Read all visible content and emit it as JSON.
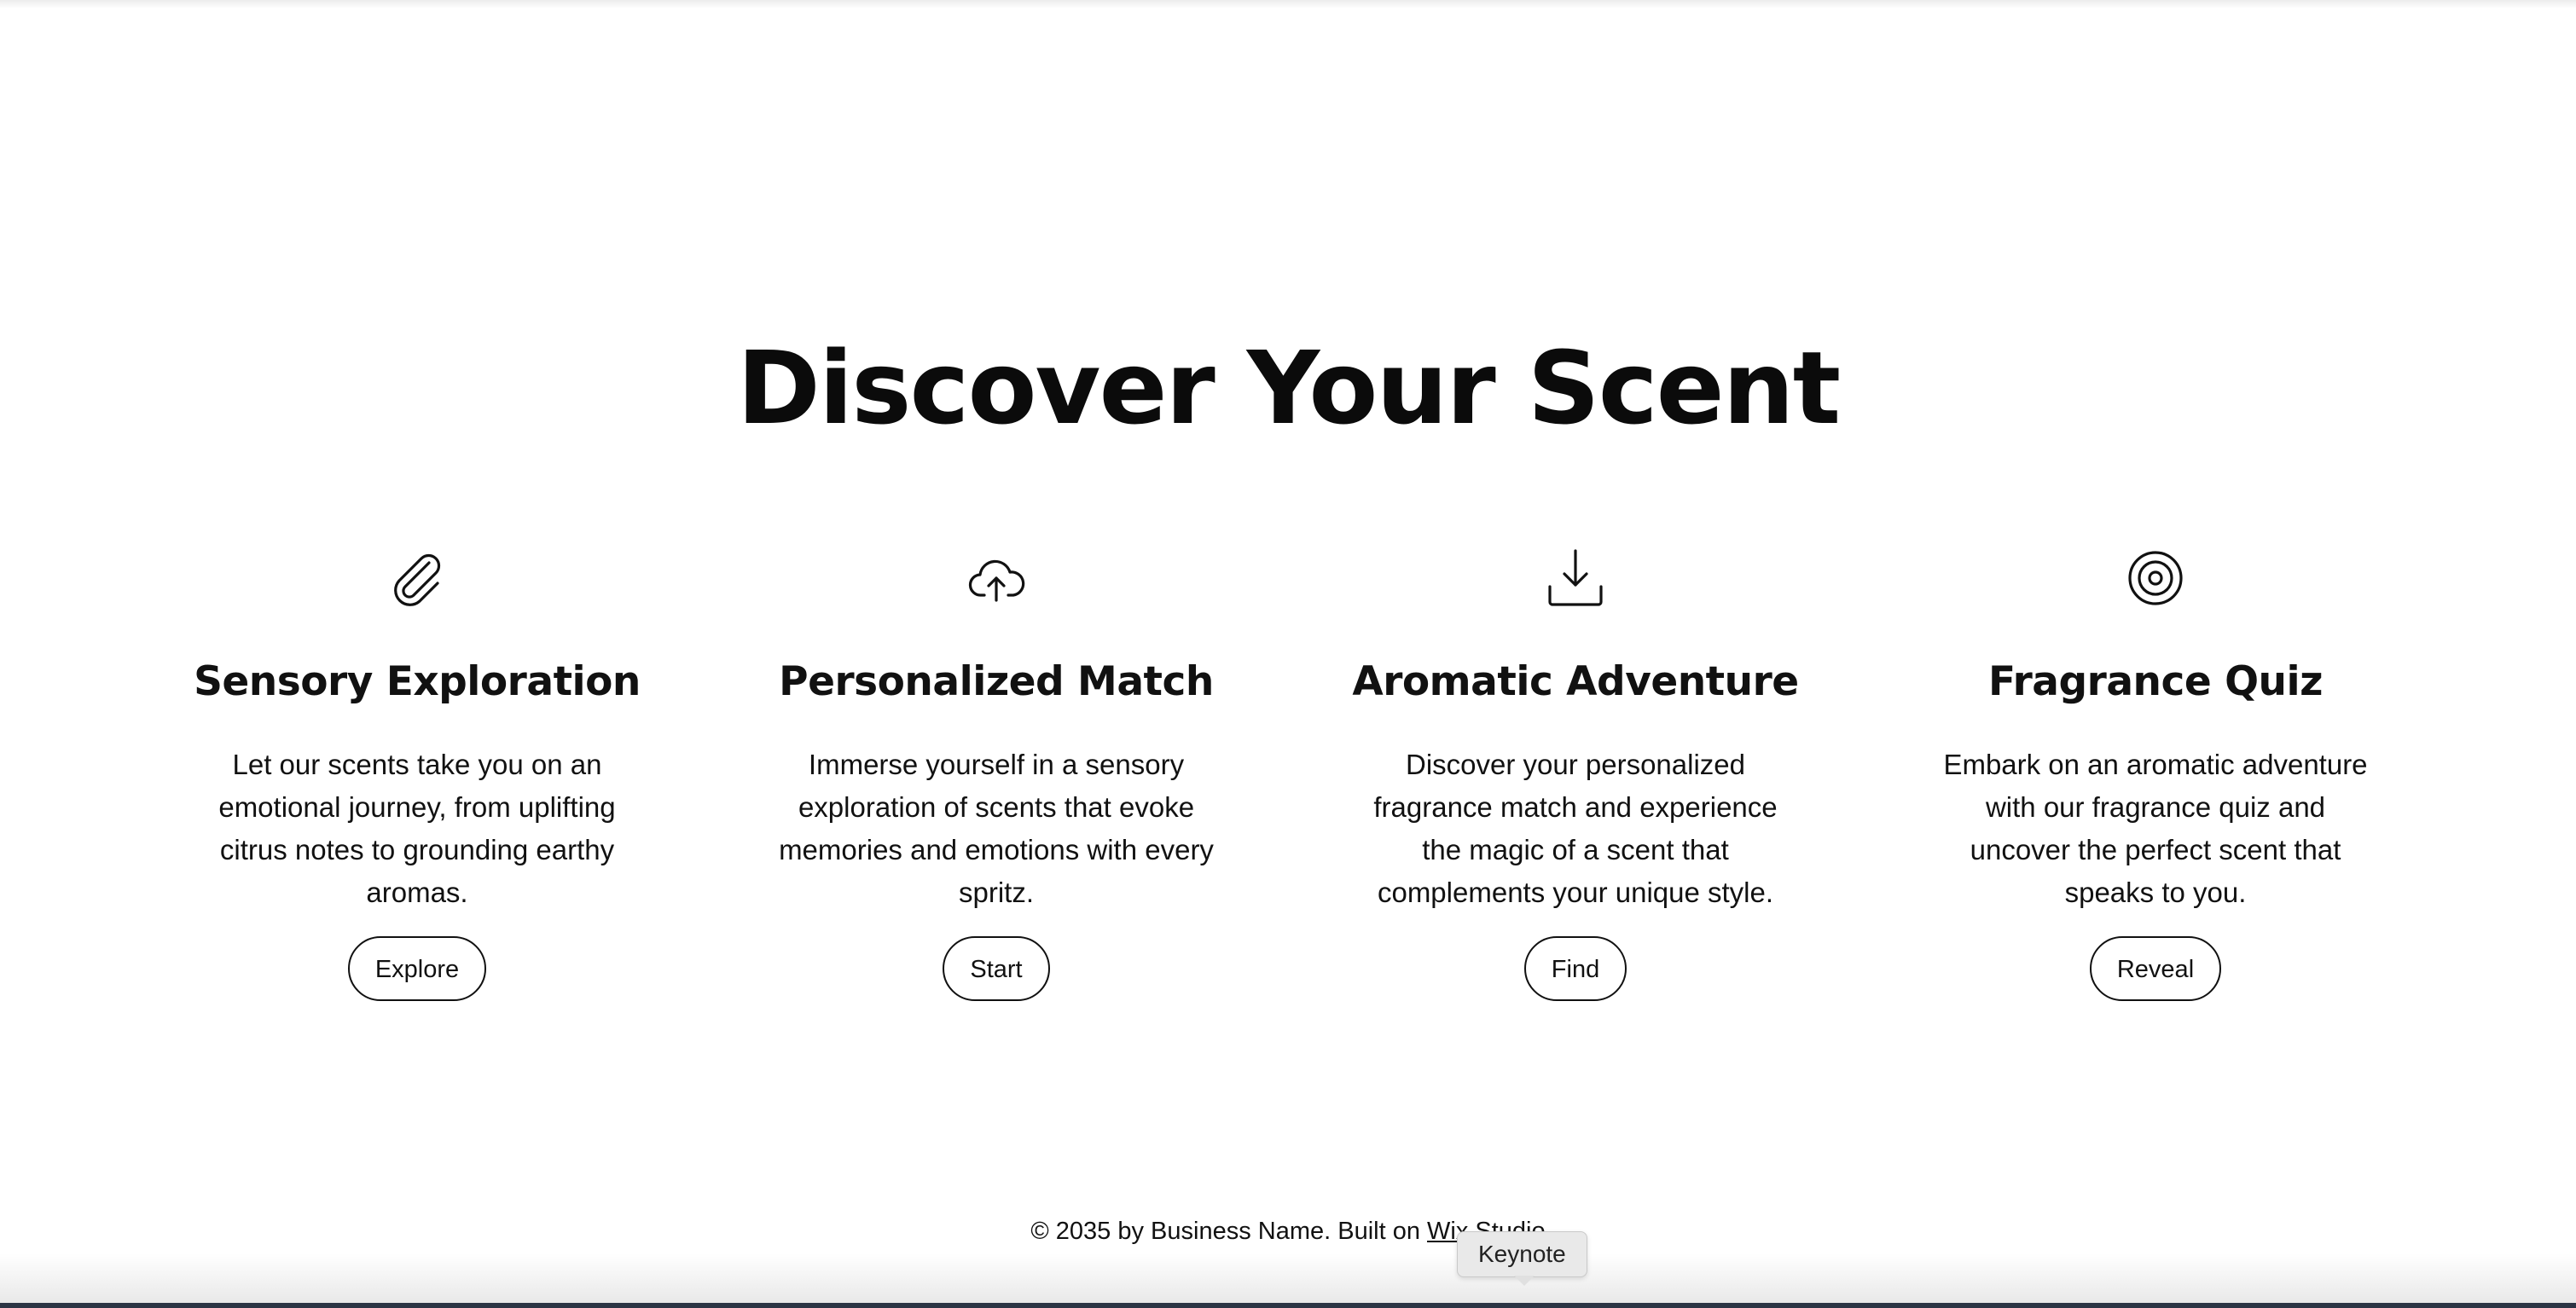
{
  "section": {
    "heading": "Discover Your Scent"
  },
  "cards": [
    {
      "icon": "paperclip-icon",
      "title": "Sensory Exploration",
      "description": "Let our scents take you on an emotional journey, from uplifting citrus notes to grounding earthy aromas.",
      "button_label": "Explore"
    },
    {
      "icon": "cloud-upload-icon",
      "title": "Personalized Match",
      "description": "Immerse yourself in a sensory exploration of scents that evoke memories and emotions with every spritz.",
      "button_label": "Start"
    },
    {
      "icon": "download-icon",
      "title": "Aromatic Adventure",
      "description": "Discover your personalized fragrance match and experience the magic of a scent that complements your unique style.",
      "button_label": "Find"
    },
    {
      "icon": "target-icon",
      "title": "Fragrance Quiz",
      "description": "Embark on an aromatic adventure with our fragrance quiz and uncover the perfect scent that speaks to you.",
      "button_label": "Reveal"
    }
  ],
  "footer": {
    "text": "© 2035 by Business Name. Built on ",
    "link_label": "Wix Studio"
  },
  "dock": {
    "tooltip": "Keynote"
  }
}
